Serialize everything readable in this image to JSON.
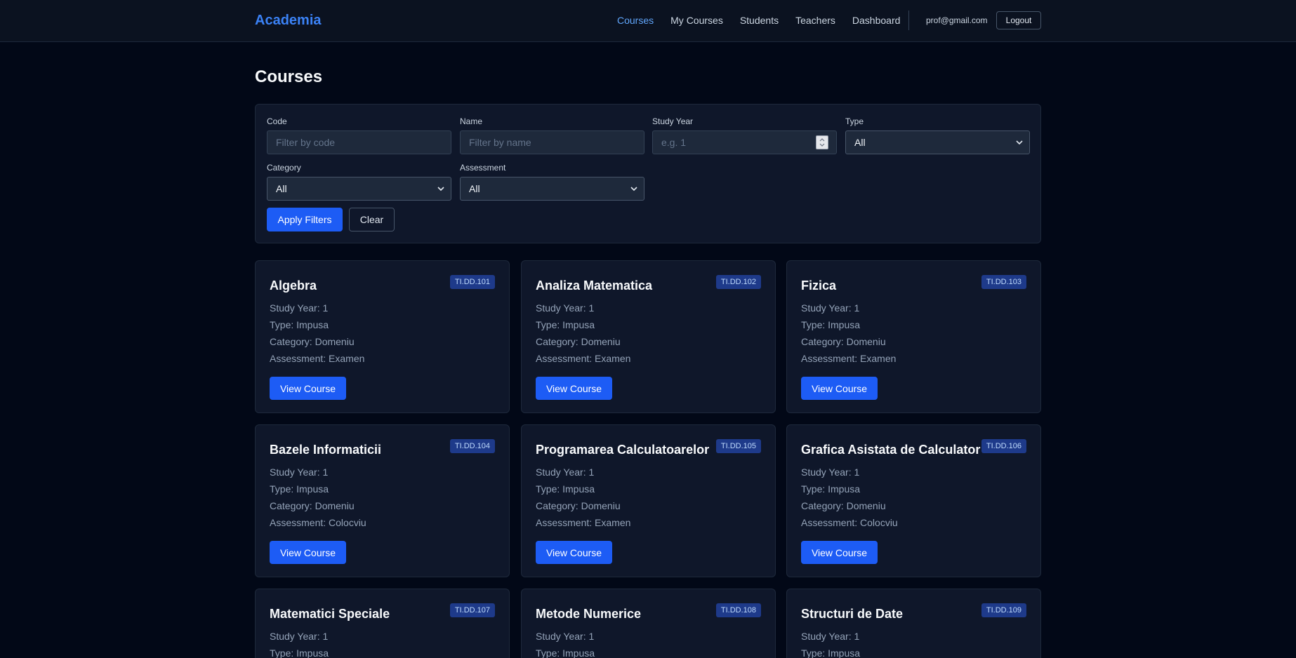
{
  "nav": {
    "brand": "Academia",
    "links": [
      "Courses",
      "My Courses",
      "Students",
      "Teachers",
      "Dashboard"
    ],
    "active": "Courses",
    "user_email": "prof@gmail.com",
    "logout_label": "Logout"
  },
  "page": {
    "title": "Courses"
  },
  "filters": {
    "code": {
      "label": "Code",
      "placeholder": "Filter by code"
    },
    "name": {
      "label": "Name",
      "placeholder": "Filter by name"
    },
    "study_year": {
      "label": "Study Year",
      "placeholder": "e.g. 1"
    },
    "type": {
      "label": "Type",
      "value": "All"
    },
    "category": {
      "label": "Category",
      "value": "All"
    },
    "assessment": {
      "label": "Assessment",
      "value": "All"
    },
    "apply_label": "Apply Filters",
    "clear_label": "Clear"
  },
  "course_button_label": "View Course",
  "courses": [
    {
      "title": "Algebra",
      "code": "TI.DD.101",
      "study_year": "Study Year: 1",
      "type": "Type: Impusa",
      "category": "Category: Domeniu",
      "assessment": "Assessment: Examen"
    },
    {
      "title": "Analiza Matematica",
      "code": "TI.DD.102",
      "study_year": "Study Year: 1",
      "type": "Type: Impusa",
      "category": "Category: Domeniu",
      "assessment": "Assessment: Examen"
    },
    {
      "title": "Fizica",
      "code": "TI.DD.103",
      "study_year": "Study Year: 1",
      "type": "Type: Impusa",
      "category": "Category: Domeniu",
      "assessment": "Assessment: Examen"
    },
    {
      "title": "Bazele Informaticii",
      "code": "TI.DD.104",
      "study_year": "Study Year: 1",
      "type": "Type: Impusa",
      "category": "Category: Domeniu",
      "assessment": "Assessment: Colocviu"
    },
    {
      "title": "Programarea Calculatoarelor",
      "code": "TI.DD.105",
      "study_year": "Study Year: 1",
      "type": "Type: Impusa",
      "category": "Category: Domeniu",
      "assessment": "Assessment: Examen"
    },
    {
      "title": "Grafica Asistata de Calculator",
      "code": "TI.DD.106",
      "study_year": "Study Year: 1",
      "type": "Type: Impusa",
      "category": "Category: Domeniu",
      "assessment": "Assessment: Colocviu"
    },
    {
      "title": "Matematici Speciale",
      "code": "TI.DD.107",
      "study_year": "Study Year: 1",
      "type": "Type: Impusa"
    },
    {
      "title": "Metode Numerice",
      "code": "TI.DD.108",
      "study_year": "Study Year: 1",
      "type": "Type: Impusa"
    },
    {
      "title": "Structuri de Date",
      "code": "TI.DD.109",
      "study_year": "Study Year: 1",
      "type": "Type: Impusa"
    }
  ]
}
